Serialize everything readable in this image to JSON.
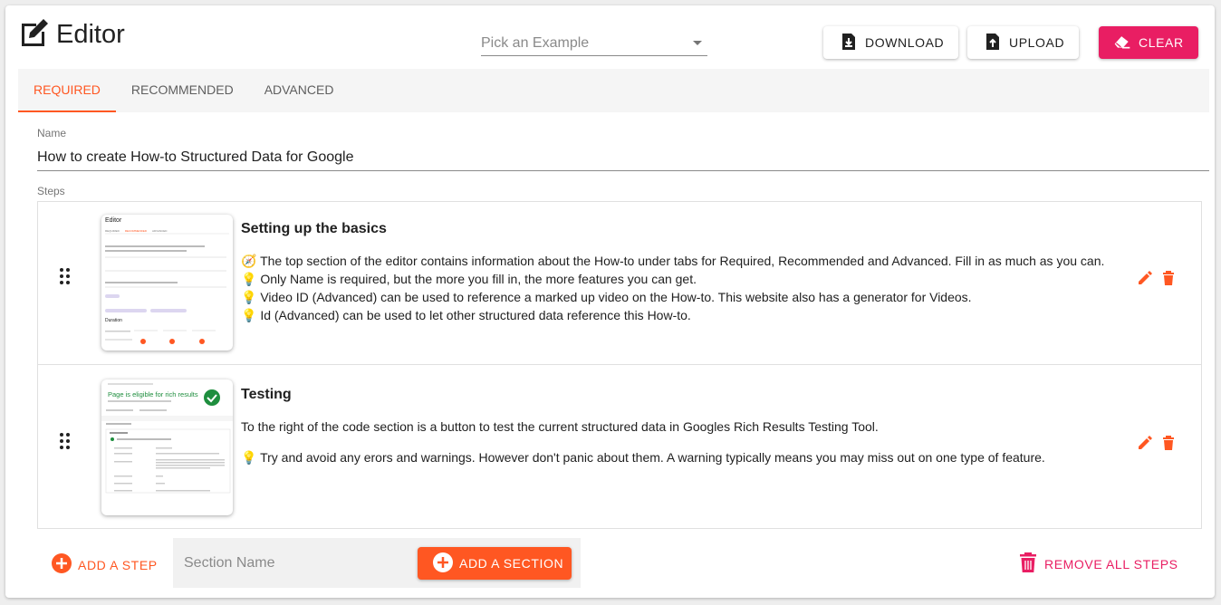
{
  "header": {
    "title": "Editor",
    "example_placeholder": "Pick an Example",
    "download_label": "DOWNLOAD",
    "upload_label": "UPLOAD",
    "clear_label": "CLEAR"
  },
  "tabs": [
    {
      "label": "REQUIRED",
      "active": true
    },
    {
      "label": "RECOMMENDED",
      "active": false
    },
    {
      "label": "ADVANCED",
      "active": false
    }
  ],
  "name_field": {
    "label": "Name",
    "value": "How to create How-to Structured Data for Google"
  },
  "steps_label": "Steps",
  "steps": [
    {
      "title": "Setting up the basics",
      "lines": [
        "🧭 The top section of the editor contains information about the How-to under tabs for Required, Recommended and Advanced. Fill in as much as you can.",
        "💡 Only Name is required, but the more you fill in, the more features you can get.",
        "💡 Video ID (Advanced) can be used to reference a marked up video on the How-to. This website also has a generator for Videos.",
        "💡 Id (Advanced) can be used to let other structured data reference this How-to."
      ],
      "thumbnail": {
        "title": "Editor",
        "tabs": [
          "REQUIRED",
          "RECOMMENDED",
          "ADVANCED"
        ],
        "duration_label": "Duration"
      }
    },
    {
      "title": "Testing",
      "lines": [
        "To the right of the code section is a button to test the current structured data in Googles Rich Results Testing Tool.",
        "💡 Try and avoid any erors and warnings. However don't panic about them. A warning typically means you may miss out on one type of feature."
      ],
      "thumbnail": {
        "headline": "Page is eligible for rich results"
      }
    }
  ],
  "footer": {
    "add_step_label": "ADD A STEP",
    "section_name_placeholder": "Section Name",
    "add_section_label": "ADD A SECTION",
    "remove_all_label": "REMOVE ALL STEPS"
  },
  "colors": {
    "accent": "#ff5722",
    "pink": "#e91e63",
    "success": "#1e8e3e"
  }
}
